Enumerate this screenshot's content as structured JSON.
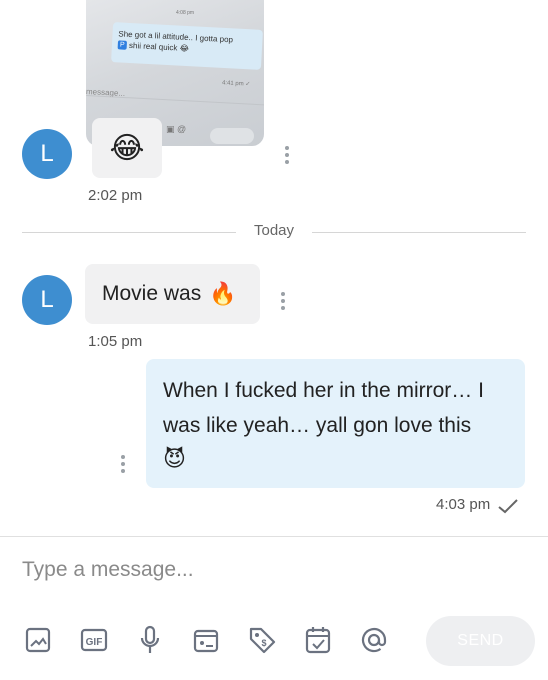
{
  "shared_image": {
    "time_label": "4:08 pm",
    "quoted_line1": "She got a lil attitude.. I gotta pop",
    "quoted_p": "P",
    "quoted_line2": "shii real quick",
    "quoted_emoji": "😂",
    "quoted_stamp": "4:41 pm ✓",
    "input_placeholder": "message..."
  },
  "messages": [
    {
      "sender_initial": "L",
      "emoji": "😂",
      "time": "2:02 pm"
    },
    {
      "sender_initial": "L",
      "text": "Movie was",
      "emoji": "🔥",
      "time": "1:05 pm"
    },
    {
      "text": "When I fucked her in the mirror… I was like yeah… yall gon love this",
      "emoji": "😈",
      "time": "4:03 pm",
      "status": "sent"
    }
  ],
  "divider_label": "Today",
  "composer": {
    "placeholder": "Type a message...",
    "tools": [
      "image-icon",
      "gif-icon",
      "microphone-icon",
      "gallery-icon",
      "tag-icon",
      "calendar-icon",
      "at-icon"
    ],
    "send_label": "SEND"
  },
  "colors": {
    "avatar": "#3e8ed0",
    "incoming_bubble": "#f1f1f2",
    "outgoing_bubble": "#e4f2fb",
    "icon": "#6b7280"
  }
}
